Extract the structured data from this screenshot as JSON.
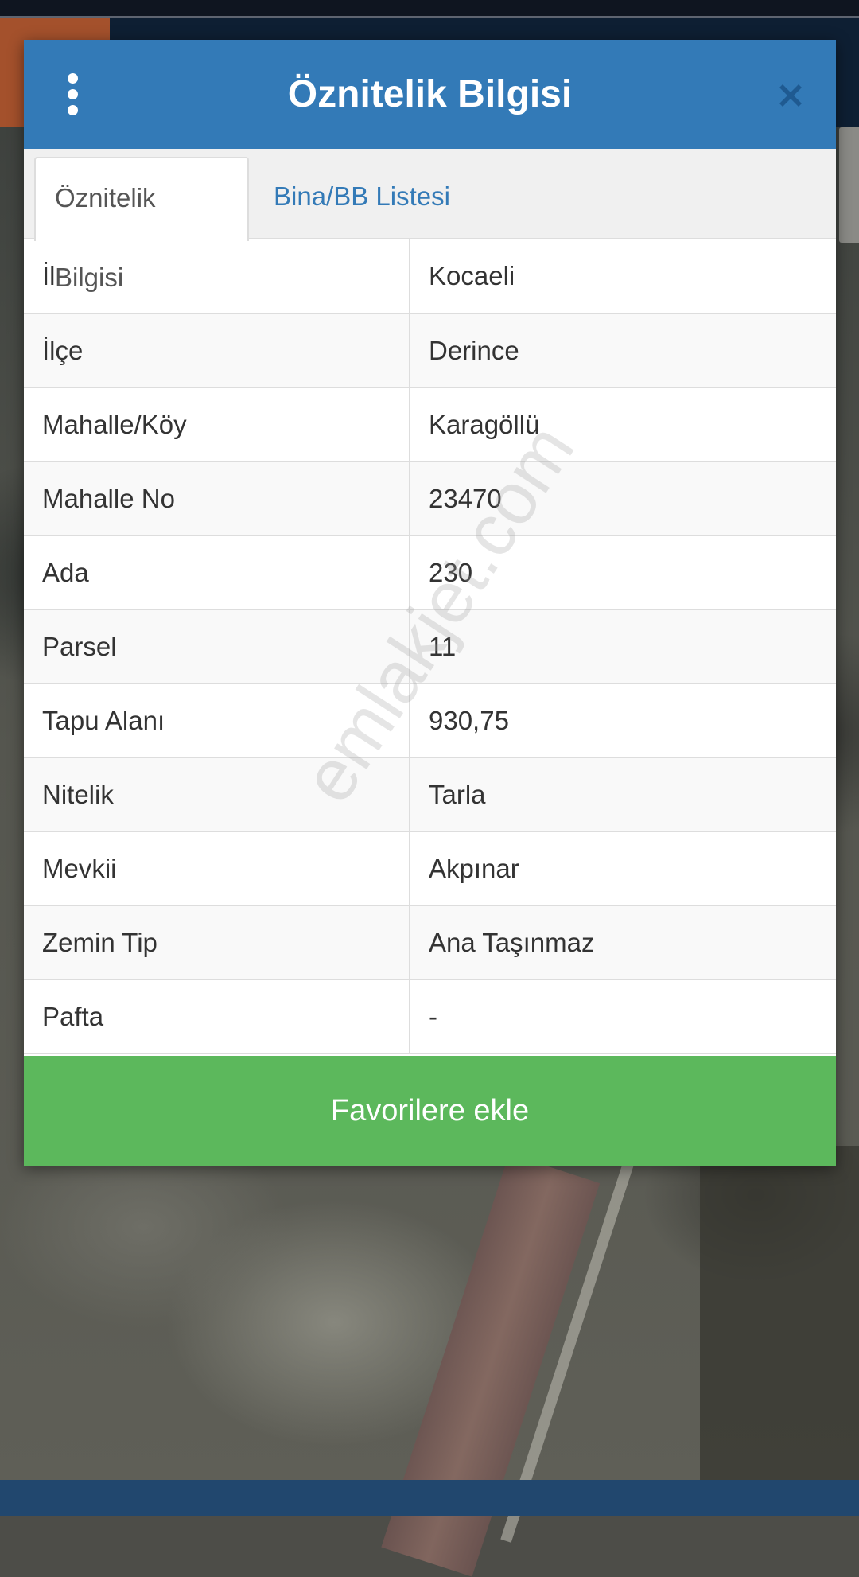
{
  "modal": {
    "title": "Öznitelik Bilgisi",
    "menu_icon": "vertical-dots-icon",
    "close_icon": "close-icon"
  },
  "tabs": [
    {
      "label": "Öznitelik Bilgisi",
      "active": true
    },
    {
      "label": "Bina/BB Listesi",
      "active": false
    }
  ],
  "attributes": [
    {
      "key": "İl",
      "value": "Kocaeli"
    },
    {
      "key": "İlçe",
      "value": "Derince"
    },
    {
      "key": "Mahalle/Köy",
      "value": "Karagöllü"
    },
    {
      "key": "Mahalle No",
      "value": "23470"
    },
    {
      "key": "Ada",
      "value": "230"
    },
    {
      "key": "Parsel",
      "value": "11"
    },
    {
      "key": "Tapu Alanı",
      "value": "930,75"
    },
    {
      "key": "Nitelik",
      "value": "Tarla"
    },
    {
      "key": "Mevkii",
      "value": "Akpınar"
    },
    {
      "key": "Zemin Tip",
      "value": "Ana Taşınmaz"
    },
    {
      "key": "Pafta",
      "value": "-"
    }
  ],
  "favorite_button": {
    "label": "Favorilere ekle"
  },
  "watermark": "emlakjet.com",
  "colors": {
    "header": "#337ab7",
    "tab_link": "#337ab7",
    "favorite_button": "#5cb85c"
  }
}
